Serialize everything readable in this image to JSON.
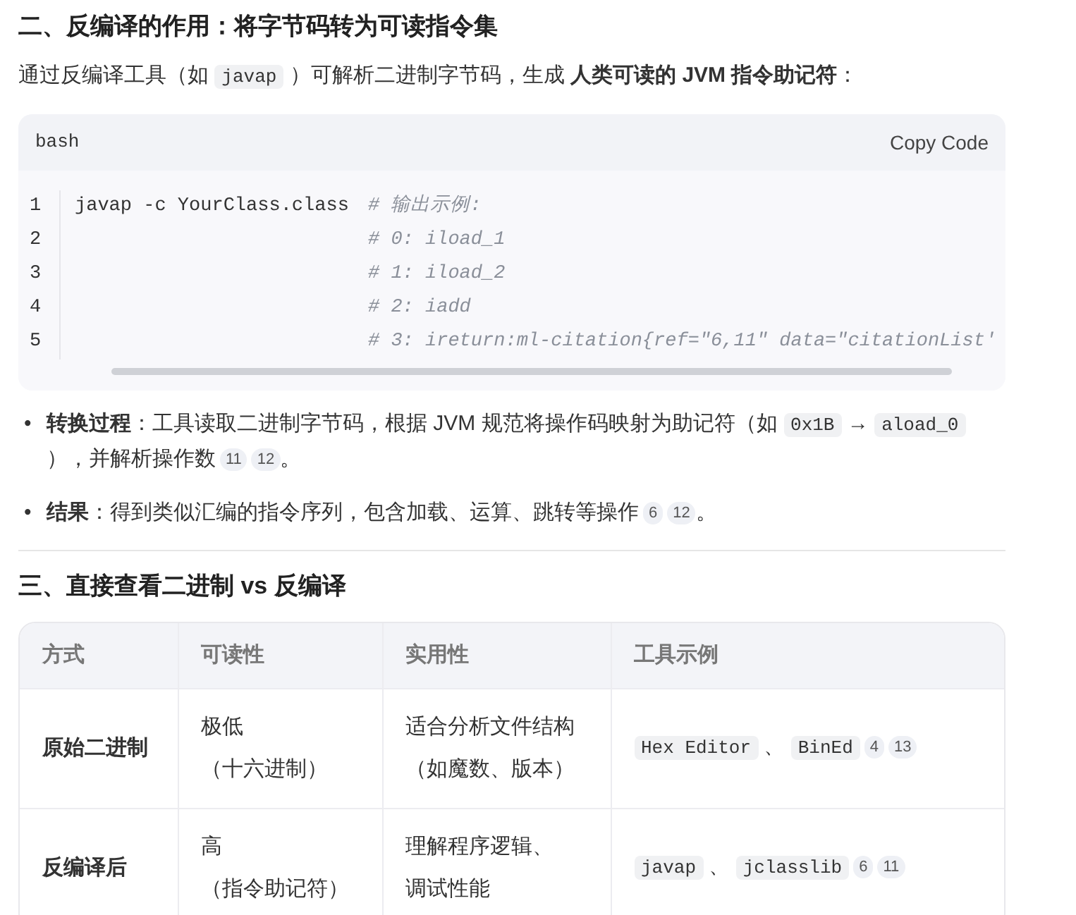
{
  "section_2": {
    "heading": "二、反编译的作用：将字节码转为可读指令集",
    "intro": [
      {
        "kind": "text",
        "text": "通过反编译工具（如 "
      },
      {
        "kind": "code",
        "text": "javap"
      },
      {
        "kind": "text",
        "text": " ）可解析二进制字节码，生成 **人类可读的 JVM 指令助记符**："
      }
    ],
    "code_block": {
      "language": "bash",
      "copy_label": "Copy Code",
      "lines": [
        {
          "number": "1",
          "code": "javap -c YourClass.class",
          "comment": "# 输出示例:"
        },
        {
          "number": "2",
          "comment": "# 0: iload_1"
        },
        {
          "number": "3",
          "comment": "# 1: iload_2"
        },
        {
          "number": "4",
          "comment": "# 2: iadd"
        },
        {
          "number": "5",
          "comment": "# 3: ireturn:ml-citation{ref=\"6,11\" data=\"citationList'"
        }
      ]
    },
    "bullets": [
      {
        "marker": "•",
        "label": "转换过程",
        "parts": [
          {
            "kind": "text",
            "text": "：工具读取二进制字节码，根据 JVM 规范将操作码映射为助记符（如 "
          },
          {
            "kind": "code",
            "text": "0x1B"
          },
          {
            "kind": "text",
            "text": " → "
          },
          {
            "kind": "code",
            "text": "aload_0"
          },
          {
            "kind": "text",
            "text": " ），并解析操作数"
          },
          {
            "kind": "cite",
            "text": "11"
          },
          {
            "kind": "cite",
            "text": "12"
          },
          {
            "kind": "text",
            "text": "。"
          }
        ]
      },
      {
        "marker": "•",
        "label": "结果",
        "parts": [
          {
            "kind": "text",
            "text": "：得到类似汇编的指令序列，包含加载、运算、跳转等操作"
          },
          {
            "kind": "cite",
            "text": "6"
          },
          {
            "kind": "cite",
            "text": "12"
          },
          {
            "kind": "text",
            "text": "。"
          }
        ]
      }
    ]
  },
  "section_3": {
    "heading": "三、直接查看二进制 vs 反编译",
    "table": {
      "columns": [
        "方式",
        "可读性",
        "实用性",
        "工具示例"
      ],
      "rows": [
        {
          "method": "原始二进制",
          "readability": [
            "极低",
            "（十六进制）"
          ],
          "usefulness": [
            "适合分析文件结构",
            "（如魔数、版本）"
          ],
          "tools": [
            {
              "kind": "code",
              "text": "Hex Editor"
            },
            {
              "kind": "text",
              "text": " 、 "
            },
            {
              "kind": "code",
              "text": "BinEd"
            },
            {
              "kind": "cite",
              "text": "4"
            },
            {
              "kind": "cite",
              "text": "13"
            }
          ]
        },
        {
          "method": "反编译后",
          "readability": [
            "高",
            "（指令助记符）"
          ],
          "usefulness": [
            "理解程序逻辑、",
            "调试性能"
          ],
          "tools": [
            {
              "kind": "code",
              "text": "javap"
            },
            {
              "kind": "text",
              "text": " 、 "
            },
            {
              "kind": "code",
              "text": "jclasslib"
            },
            {
              "kind": "cite",
              "text": "6"
            },
            {
              "kind": "cite",
              "text": "11"
            }
          ]
        }
      ]
    }
  }
}
